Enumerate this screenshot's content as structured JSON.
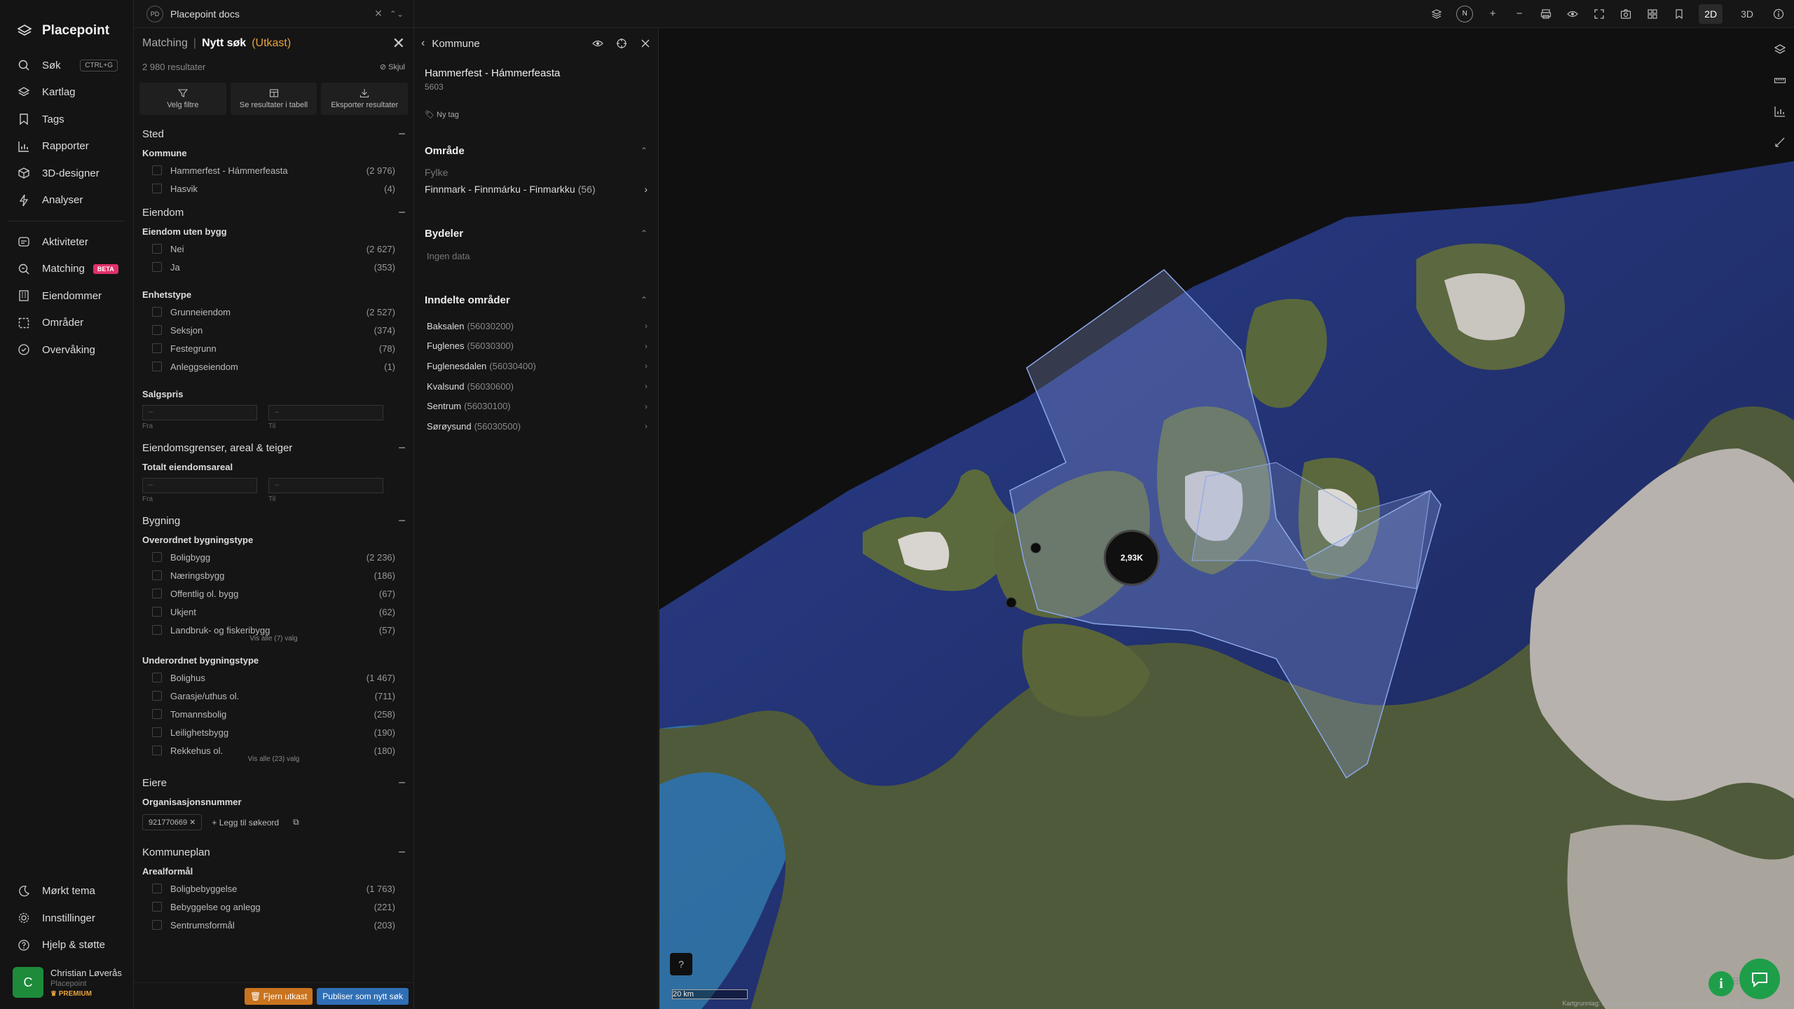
{
  "nav": {
    "logo": "Placepoint",
    "items": [
      {
        "label": "Søk",
        "shortcut": "CTRL+G"
      },
      {
        "label": "Kartlag"
      },
      {
        "label": "Tags"
      },
      {
        "label": "Rapporter"
      },
      {
        "label": "3D-designer"
      },
      {
        "label": "Analyser"
      }
    ],
    "items2": [
      {
        "label": "Aktiviteter"
      },
      {
        "label": "Matching",
        "badge": "BETA"
      },
      {
        "label": "Eiendommer"
      },
      {
        "label": "Områder"
      },
      {
        "label": "Overvåking"
      }
    ],
    "bottom": [
      {
        "label": "Mørkt tema"
      },
      {
        "label": "Innstillinger"
      },
      {
        "label": "Hjelp & støtte"
      }
    ],
    "user": {
      "initial": "C",
      "name": "Christian Løverås",
      "org": "Placepoint",
      "plan": "PREMIUM"
    }
  },
  "topbar": {
    "doc_badge": "PD",
    "doc_name": "Placepoint docs",
    "compass": "N",
    "mode_2d": "2D",
    "mode_3d": "3D"
  },
  "matching": {
    "crumb": "Matching",
    "title": "Nytt søk",
    "status": "(Utkast)",
    "results": "2 980 resultater",
    "hide": "Skjul",
    "actions": [
      "Velg filtre",
      "Se resultater i tabell",
      "Eksporter resultater"
    ],
    "sted": {
      "title": "Sted",
      "kommune_label": "Kommune",
      "kommune": [
        {
          "label": "Hammerfest - Hámmerfeasta",
          "count": "(2 976)"
        },
        {
          "label": "Hasvik",
          "count": "(4)"
        }
      ]
    },
    "eiendom": {
      "title": "Eiendom",
      "uten_bygg_label": "Eiendom uten bygg",
      "uten_bygg": [
        {
          "label": "Nei",
          "count": "(2 627)"
        },
        {
          "label": "Ja",
          "count": "(353)"
        }
      ],
      "enhetstype_label": "Enhetstype",
      "enhetstype": [
        {
          "label": "Grunneiendom",
          "count": "(2 527)"
        },
        {
          "label": "Seksjon",
          "count": "(374)"
        },
        {
          "label": "Festegrunn",
          "count": "(78)"
        },
        {
          "label": "Anleggseiendom",
          "count": "(1)"
        }
      ],
      "salgspris_label": "Salgspris",
      "fra": "Fra",
      "til": "Til",
      "dash": "–"
    },
    "grenser": {
      "title": "Eiendomsgrenser, areal & teiger",
      "areal_label": "Totalt eiendomsareal"
    },
    "bygning": {
      "title": "Bygning",
      "over_label": "Overordnet bygningstype",
      "over": [
        {
          "label": "Boligbygg",
          "count": "(2 236)"
        },
        {
          "label": "Næringsbygg",
          "count": "(186)"
        },
        {
          "label": "Offentlig ol. bygg",
          "count": "(67)"
        },
        {
          "label": "Ukjent",
          "count": "(62)"
        },
        {
          "label": "Landbruk- og fiskeribygg",
          "count": "(57)"
        }
      ],
      "over_more": "Vis alle (7) valg",
      "under_label": "Underordnet bygningstype",
      "under": [
        {
          "label": "Bolighus",
          "count": "(1 467)"
        },
        {
          "label": "Garasje/uthus ol.",
          "count": "(711)"
        },
        {
          "label": "Tomannsbolig",
          "count": "(258)"
        },
        {
          "label": "Leilighetsbygg",
          "count": "(190)"
        },
        {
          "label": "Rekkehus ol.",
          "count": "(180)"
        }
      ],
      "under_more": "Vis alle (23) valg"
    },
    "eiere": {
      "title": "Eiere",
      "org_label": "Organisasjonsnummer",
      "tag": "921770669",
      "add": "Legg til søkeord"
    },
    "kommuneplan": {
      "title": "Kommuneplan",
      "arealformal_label": "Arealformål",
      "items": [
        {
          "label": "Boligbebyggelse",
          "count": "(1 763)"
        },
        {
          "label": "Bebyggelse og anlegg",
          "count": "(221)"
        },
        {
          "label": "Sentrumsformål",
          "count": "(203)"
        }
      ]
    },
    "footer": {
      "remove": "Fjern utkast",
      "publish": "Publiser som nytt søk"
    }
  },
  "kommune": {
    "title": "Kommune",
    "name": "Hammerfest - Hámmerfeasta",
    "code": "5603",
    "ny_tag": "Ny tag",
    "omrade": {
      "title": "Område",
      "fylke_label": "Fylke",
      "fylke": "Finnmark - Finnmárku - Finmarkku",
      "fylke_count": "(56)"
    },
    "bydeler": {
      "title": "Bydeler",
      "empty": "Ingen data"
    },
    "inndelte": {
      "title": "Inndelte områder",
      "items": [
        {
          "name": "Baksalen",
          "code": "(56030200)"
        },
        {
          "name": "Fuglenes",
          "code": "(56030300)"
        },
        {
          "name": "Fuglenesdalen",
          "code": "(56030400)"
        },
        {
          "name": "Kvalsund",
          "code": "(56030600)"
        },
        {
          "name": "Sentrum",
          "code": "(56030100)"
        },
        {
          "name": "Sørøysund",
          "code": "(56030500)"
        }
      ]
    }
  },
  "map": {
    "cluster": "2,93K",
    "scale": "20 km",
    "credit": "Kartgrunnlag: Kartverket, Geovekst og kommuner / Geodata AS, Powered by Esri"
  }
}
